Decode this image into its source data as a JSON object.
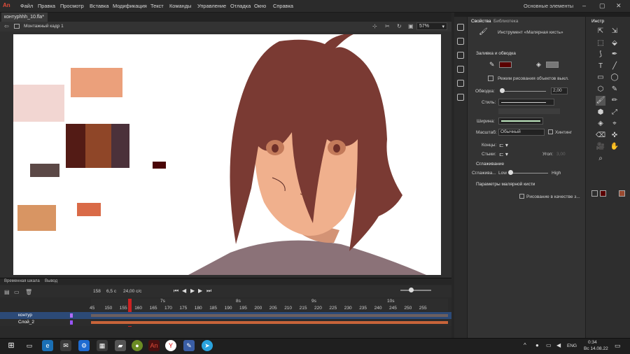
{
  "app": {
    "logo": "An"
  },
  "menu": [
    "Файл",
    "Правка",
    "Просмотр",
    "Вставка",
    "Модификация",
    "Текст",
    "Команды",
    "Управление",
    "Отладка",
    "Окно",
    "Справка"
  ],
  "workspace": "Основные элементы",
  "document": {
    "tab": "контурhhh_10.fla*",
    "scene": "Монтажный кадр 1",
    "zoom": "57%"
  },
  "swatches": [
    "#f2d6d2",
    "#eba07b",
    "#531b15",
    "#8f4628",
    "#4b313a",
    "#5b4846",
    "#4a0507",
    "#d89563",
    "#d96a47"
  ],
  "timeline": {
    "tabs": [
      "Временная шкала",
      "Вывод"
    ],
    "frame": "158",
    "time": "6,5 c",
    "fps": "24,00 с/с",
    "seconds": [
      "7s",
      "8s",
      "9s",
      "10s"
    ],
    "ticks": [
      "45",
      "150",
      "155",
      "160",
      "165",
      "170",
      "175",
      "180",
      "185",
      "190",
      "195",
      "200",
      "205",
      "210",
      "215",
      "220",
      "225",
      "230",
      "235",
      "240",
      "245",
      "250",
      "255"
    ],
    "layers": [
      {
        "name": "контур",
        "color": "#b06cff"
      },
      {
        "name": "Слой_2",
        "color": "#9955ff"
      }
    ]
  },
  "properties": {
    "tabs": [
      "Свойства",
      "Библиотека"
    ],
    "tool_name": "Инструмент «Малярная кисть»",
    "fill_stroke": "Заливка и обводка",
    "draw_objects": "Режим рисования объектов выкл.",
    "stroke_label": "Обводка:",
    "stroke_value": "2,00",
    "style_label": "Стиль:",
    "width_label": "Ширина:",
    "scale_label": "Масштаб:",
    "scale_value": "Обычный",
    "hinting": "Хинтинг",
    "caps_label": "Концы:",
    "joins_label": "Стыки:",
    "angle_label": "Угол:",
    "angle_value": "3,00",
    "smoothing": "Сглаживание",
    "smoothing_label": "Сглажива...",
    "low": "Low",
    "high": "High",
    "brush_params": "Параметры малярной кисти",
    "brush_checkbox": "Рисование в качестве з...",
    "fill_color": "#5a0000"
  },
  "tools_header": "Инстр",
  "taskbar": {
    "lang": "ENG",
    "time": "0:34",
    "date": "Вс 14.08.22"
  }
}
